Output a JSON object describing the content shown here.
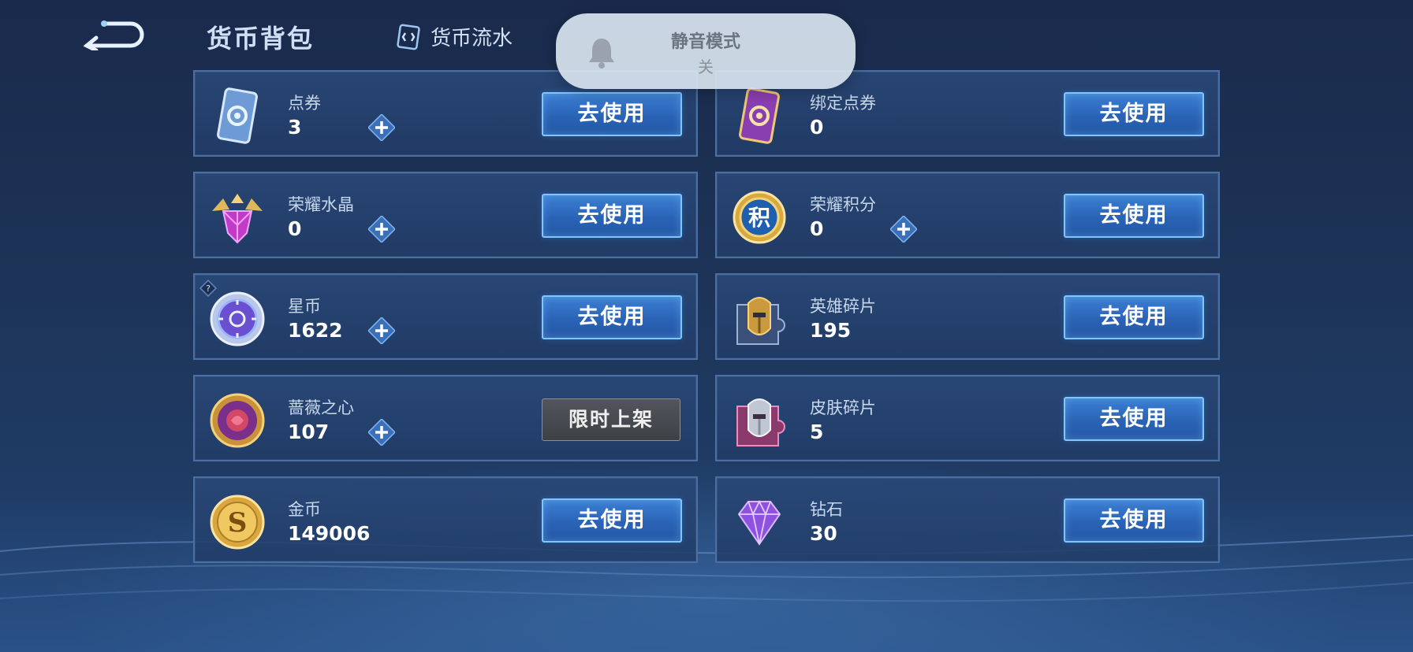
{
  "header": {
    "title": "货币背包",
    "flow_label": "货币流水"
  },
  "toast": {
    "title": "静音模式",
    "status": "关"
  },
  "currencies": [
    {
      "name": "点券",
      "value": "3",
      "action": "去使用"
    },
    {
      "name": "绑定点券",
      "value": "0",
      "action": "去使用"
    },
    {
      "name": "荣耀水晶",
      "value": "0",
      "action": "去使用"
    },
    {
      "name": "荣耀积分",
      "value": "0",
      "action": "去使用"
    },
    {
      "name": "星币",
      "value": "1622",
      "action": "去使用"
    },
    {
      "name": "英雄碎片",
      "value": "195",
      "action": "去使用"
    },
    {
      "name": "蔷薇之心",
      "value": "107",
      "action": "限时上架"
    },
    {
      "name": "皮肤碎片",
      "value": "5",
      "action": "去使用"
    },
    {
      "name": "金币",
      "value": "149006",
      "action": "去使用"
    },
    {
      "name": "钻石",
      "value": "30",
      "action": "去使用"
    }
  ],
  "icons": [
    "voucher-icon",
    "bound-voucher-icon",
    "glory-crystal-icon",
    "glory-points-icon",
    "star-coin-icon",
    "hero-fragment-icon",
    "rose-heart-icon",
    "skin-fragment-icon",
    "gold-coin-icon",
    "diamond-icon",
    "bell-icon",
    "back-arrow-icon",
    "plus-icon",
    "help-icon"
  ],
  "colors": {
    "button_blue": "#2f6cc0",
    "button_border": "#7fc6ff",
    "limited_gray": "#464a50",
    "panel": "#2a4878"
  }
}
